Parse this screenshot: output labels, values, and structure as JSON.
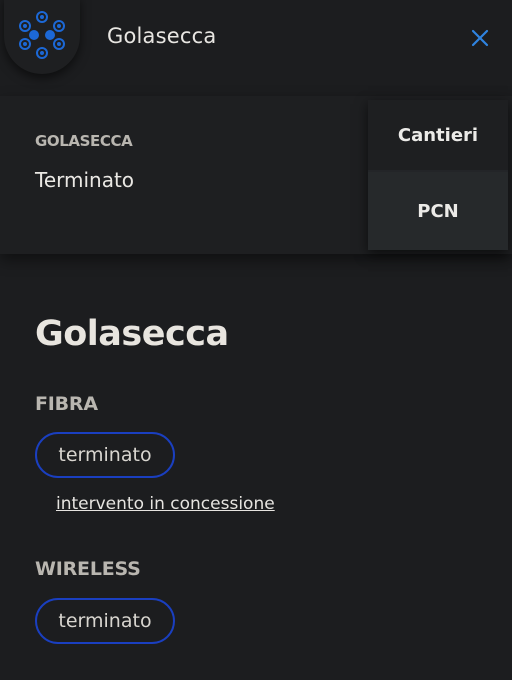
{
  "header": {
    "title": "Golasecca",
    "logo_icon": "cooperative-logo-icon",
    "close_icon": "close-icon",
    "accent_color": "#1c68d6"
  },
  "info_card": {
    "kicker": "GOLASECCA",
    "status": "Terminato"
  },
  "menu": {
    "items": [
      {
        "label": "Cantieri"
      },
      {
        "label": "PCN"
      }
    ]
  },
  "main": {
    "title": "Golasecca",
    "sections": [
      {
        "label": "FIBRA",
        "status": "terminato",
        "link": "intervento in concessione"
      },
      {
        "label": "WIRELESS",
        "status": "terminato"
      }
    ],
    "pill_border_color": "#1a3fc0"
  }
}
